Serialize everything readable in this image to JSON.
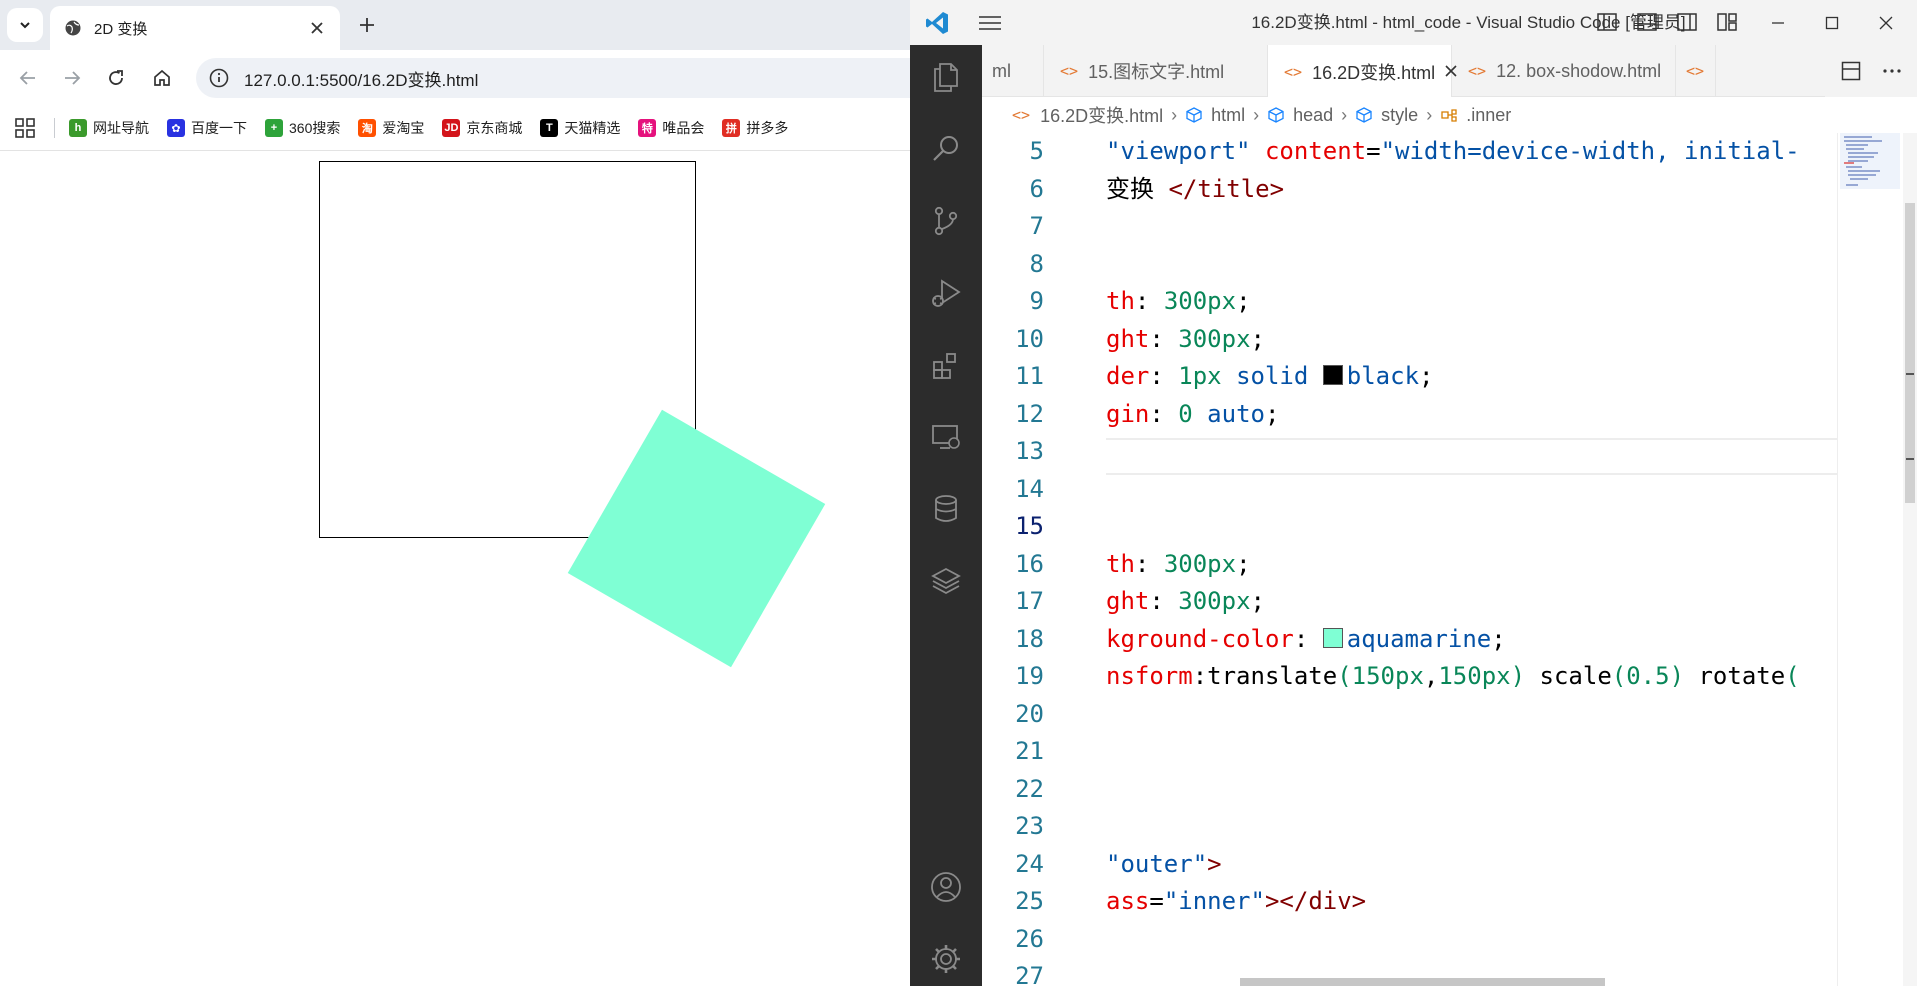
{
  "browser": {
    "tab_title": "2D 变换",
    "url": "127.0.0.1:5500/16.2D变换.html",
    "bookmarks": [
      {
        "label": "网址导航",
        "icon": "hao-icon",
        "color": "#3b9a2c",
        "glyph": "h"
      },
      {
        "label": "百度一下",
        "icon": "baidu-icon",
        "color": "#2932e1",
        "glyph": "✿"
      },
      {
        "label": "360搜索",
        "icon": "360-icon",
        "color": "#2ea33a",
        "glyph": "+"
      },
      {
        "label": "爱淘宝",
        "icon": "taobao-icon",
        "color": "#ff5000",
        "glyph": "淘"
      },
      {
        "label": "京东商城",
        "icon": "jd-icon",
        "color": "#d3141b",
        "glyph": "JD"
      },
      {
        "label": "天猫精选",
        "icon": "tmall-icon",
        "color": "#000000",
        "glyph": "T"
      },
      {
        "label": "唯品会",
        "icon": "vip-icon",
        "color": "#e5127d",
        "glyph": "特"
      },
      {
        "label": "拼多多",
        "icon": "pdd-icon",
        "color": "#e02e24",
        "glyph": "拼"
      }
    ],
    "page": {
      "outer_border_color": "#000000",
      "inner_color": "#7fffd4"
    }
  },
  "vscode": {
    "window_title": "16.2D变换.html - html_code - Visual Studio Code [管理员]",
    "tabs": [
      {
        "label": "ml",
        "partial": true
      },
      {
        "label": "15.图标文字.html"
      },
      {
        "label": "16.2D变换.html",
        "active": true
      },
      {
        "label": "12. box-shodow.html"
      }
    ],
    "breadcrumbs": [
      "16.2D变换.html",
      "html",
      "head",
      "style",
      ".inner"
    ],
    "line_numbers": [
      "5",
      "6",
      "7",
      "8",
      "9",
      "10",
      "11",
      "12",
      "13",
      "14",
      "15",
      "16",
      "17",
      "18",
      "19",
      "20",
      "21",
      "22",
      "23",
      "24",
      "25",
      "26",
      "27"
    ],
    "current_line": "15",
    "code": {
      "l5_a": "\"viewport\"",
      "l5_b": "content",
      "l5_c": "=",
      "l5_d": "\"width=device-width, initial-",
      "l6_a": "变换 ",
      "l6_b": "</title>",
      "l9_p": "th",
      "l9_c": ": ",
      "l9_n": "300px",
      "l9_s": ";",
      "l10_p": "ght",
      "l10_c": ": ",
      "l10_n": "300px",
      "l10_s": ";",
      "l11_p": "der",
      "l11_c": ": ",
      "l11_n": "1px",
      "l11_v1": "solid",
      "l11_v2": "black",
      "l11_s": ";",
      "l12_p": "gin",
      "l12_c": ": ",
      "l12_n": "0",
      "l12_v": "auto",
      "l12_s": ";",
      "l16_p": "th",
      "l16_c": ": ",
      "l16_n": "300px",
      "l16_s": ";",
      "l17_p": "ght",
      "l17_c": ": ",
      "l17_n": "300px",
      "l17_s": ";",
      "l18_p": "kground-color",
      "l18_c": ": ",
      "l18_v": "aquamarine",
      "l18_s": ";",
      "l19_p": "nsform",
      "l19_c": ":",
      "l19_f1": "translate",
      "l19_o1": "(",
      "l19_n1": "150px",
      "l19_cm": ",",
      "l19_n2": "150px",
      "l19_cl1": ")",
      "l19_f2": "scale",
      "l19_o2": "(",
      "l19_n3": "0.5",
      "l19_cl2": ")",
      "l19_f3": "rotate",
      "l19_o3": "(",
      "l24_a": "\"outer\"",
      "l24_b": ">",
      "l25_a": "ass",
      "l25_b": "=",
      "l25_c": "\"inner\"",
      "l25_d": "></div>"
    },
    "swatch_black": "#000000",
    "swatch_aqua": "#7fffd4"
  }
}
